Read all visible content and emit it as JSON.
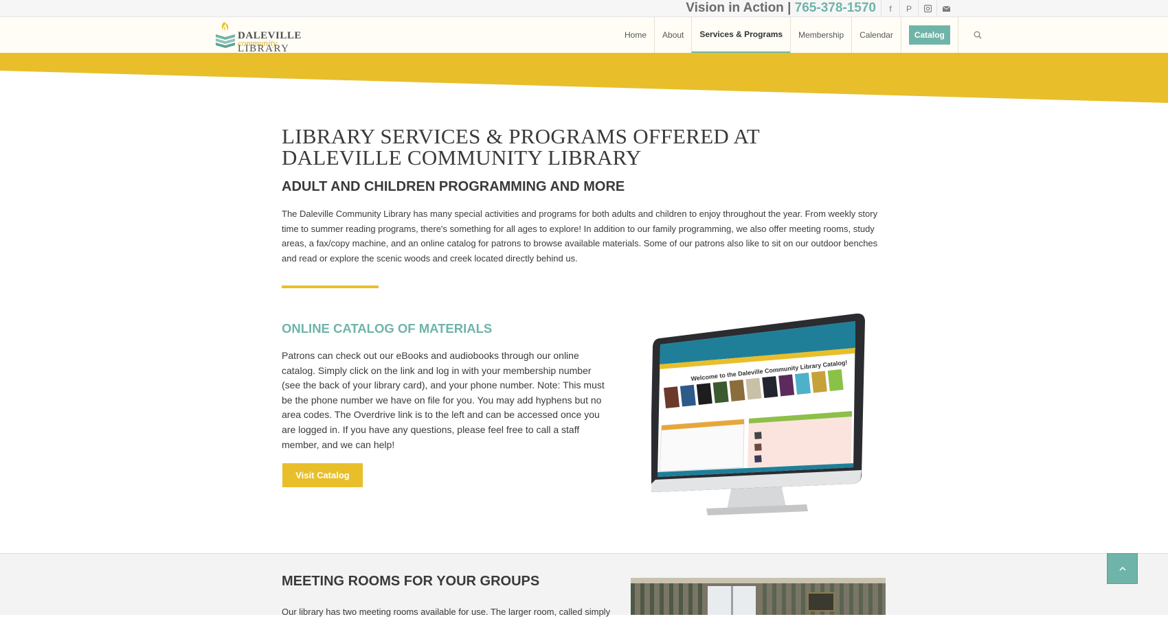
{
  "topbar": {
    "tagline_text": "Vision in Action",
    "tagline_sep": "|",
    "phone": "765-378-1570",
    "social": [
      {
        "icon": "facebook-icon",
        "glyph": "f"
      },
      {
        "icon": "pinterest-icon",
        "glyph": "P"
      },
      {
        "icon": "instagram-icon",
        "glyph": ""
      },
      {
        "icon": "mail-icon",
        "glyph": ""
      }
    ]
  },
  "logo": {
    "line1": "DALEVILLE",
    "line2": "community",
    "line3": "LIBRARY"
  },
  "nav": {
    "items": [
      {
        "label": "Home"
      },
      {
        "label": "About"
      },
      {
        "label": "Services & Programs",
        "active": true
      },
      {
        "label": "Membership"
      },
      {
        "label": "Calendar"
      }
    ],
    "catalog_label": "Catalog"
  },
  "main": {
    "title_line1": "LIBRARY SERVICES & PROGRAMS OFFERED AT",
    "title_line2": "DALEVILLE COMMUNITY LIBRARY",
    "subtitle": "ADULT AND CHILDREN PROGRAMMING AND MORE",
    "intro": "The Daleville Community Library has many special activities and programs for both adults and children to enjoy throughout the year. From weekly story time to summer reading programs, there's something for all ages to explore! In addition to our family programming, we also offer meeting rooms, study areas, a fax/copy machine, and an online catalog for patrons to browse available materials. Some of our patrons also like to sit on our outdoor benches and read or explore the scenic woods and creek located directly behind us."
  },
  "catalog_section": {
    "heading": "ONLINE CATALOG OF MATERIALS",
    "body": "Patrons can check out our eBooks and audiobooks through our online catalog. Simply click on the link and log in with your membership number (see the back of your library card), and your phone number. Note: This must be the phone number we have on file for you. You may add hyphens but no area codes. The Overdrive link is to the left and can be accessed once you are logged in. If you have any questions, please feel free to call a staff member, and we can help!",
    "button_label": "Visit Catalog",
    "screen_title": "Welcome to the Daleville Community Library Catalog!"
  },
  "meeting_section": {
    "heading": "MEETING ROOMS FOR YOUR GROUPS",
    "body_start": "Our library has two meeting rooms available for use. The larger room, called simply"
  },
  "colors": {
    "accent_teal": "#6fb4a8",
    "accent_gold": "#e8bf2b"
  }
}
